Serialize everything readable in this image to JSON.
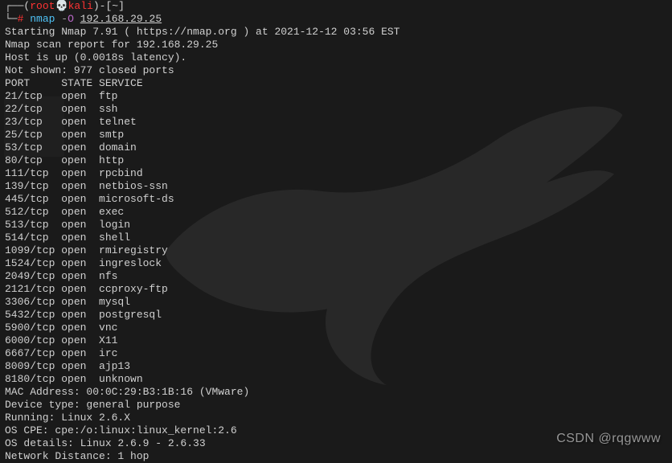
{
  "prompt": {
    "user": "root",
    "host": "kali",
    "cwd": "~",
    "symbol": "#"
  },
  "command": {
    "bin": "nmap",
    "flag_dash": "-",
    "flag_letter": "O",
    "target": "192.168.29.25"
  },
  "output": {
    "header": "Starting Nmap 7.91 ( https://nmap.org ) at 2021-12-12 03:56 EST",
    "scan_report": "Nmap scan report for 192.168.29.25",
    "host_status": "Host is up (0.0018s latency).",
    "not_shown": "Not shown: 977 closed ports",
    "columns": "PORT     STATE SERVICE",
    "ports": [
      "21/tcp   open  ftp",
      "22/tcp   open  ssh",
      "23/tcp   open  telnet",
      "25/tcp   open  smtp",
      "53/tcp   open  domain",
      "80/tcp   open  http",
      "111/tcp  open  rpcbind",
      "139/tcp  open  netbios-ssn",
      "445/tcp  open  microsoft-ds",
      "512/tcp  open  exec",
      "513/tcp  open  login",
      "514/tcp  open  shell",
      "1099/tcp open  rmiregistry",
      "1524/tcp open  ingreslock",
      "2049/tcp open  nfs",
      "2121/tcp open  ccproxy-ftp",
      "3306/tcp open  mysql",
      "5432/tcp open  postgresql",
      "5900/tcp open  vnc",
      "6000/tcp open  X11",
      "6667/tcp open  irc",
      "8009/tcp open  ajp13",
      "8180/tcp open  unknown"
    ],
    "mac": "MAC Address: 00:0C:29:B3:1B:16 (VMware)",
    "device_type": "Device type: general purpose",
    "running": "Running: Linux 2.6.X",
    "os_cpe": "OS CPE: cpe:/o:linux:linux_kernel:2.6",
    "os_details": "OS details: Linux 2.6.9 - 2.6.33",
    "distance": "Network Distance: 1 hop"
  },
  "watermark": "CSDN @rqgwww"
}
